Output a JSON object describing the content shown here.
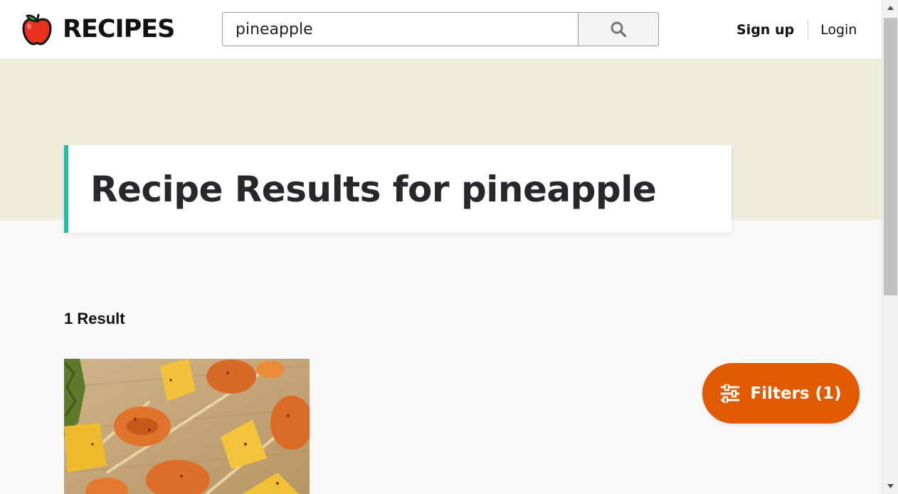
{
  "header": {
    "logo_text": "RECIPES",
    "logo_icon": "apple-icon",
    "search": {
      "value": "pineapple",
      "button_icon": "search-icon"
    },
    "signup_label": "Sign up",
    "login_label": "Login"
  },
  "hero": {
    "title": "Recipe Results for pineapple"
  },
  "results": {
    "count_label": "1 Result",
    "items": [
      {
        "image": "pineapple-shrimp-skewers-photo"
      }
    ]
  },
  "filters": {
    "label": "Filters (1)",
    "icon": "sliders-icon"
  },
  "colors": {
    "accent_teal": "#1dbfa8",
    "filters_orange": "#e05a00",
    "hero_band": "#eeeddc",
    "apple_red": "#e8311e",
    "leaf_green": "#2fae2a"
  }
}
